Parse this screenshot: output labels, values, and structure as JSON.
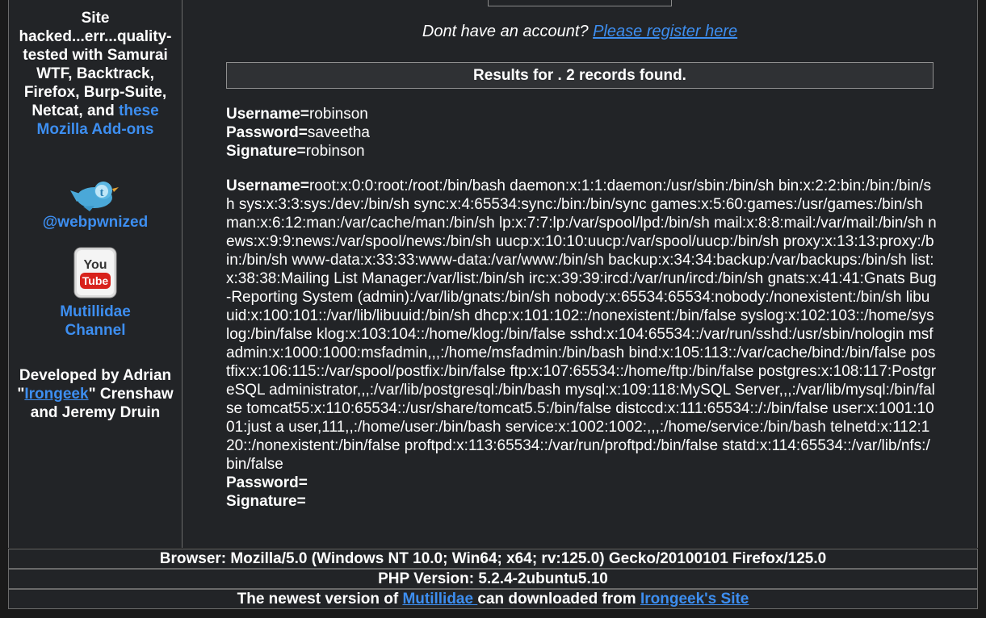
{
  "sidebar": {
    "blurb_prefix": "Site hacked...err...quality-tested with Samurai WTF, Backtrack, Firefox, Burp-Suite, Netcat, and ",
    "blurb_link": "these Mozilla Add-ons",
    "twitter_handle": "@webpwnized",
    "youtube_label": "Mutillidae Channel",
    "dev_prefix": "Developed by Adrian \"",
    "dev_link": "Irongeek",
    "dev_suffix": "\" Crenshaw and Jeremy Druin"
  },
  "main": {
    "register_prompt": "Dont have an account?",
    "register_link": "Please register here",
    "results_header": "Results for . 2 records found.",
    "records": [
      {
        "username_label": "Username=",
        "username": "robinson",
        "password_label": "Password=",
        "password": "saveetha",
        "signature_label": "Signature=",
        "signature": "robinson"
      },
      {
        "username_label": "Username=",
        "username": "root:x:0:0:root:/root:/bin/bash daemon:x:1:1:daemon:/usr/sbin:/bin/sh bin:x:2:2:bin:/bin:/bin/sh sys:x:3:3:sys:/dev:/bin/sh sync:x:4:65534:sync:/bin:/bin/sync games:x:5:60:games:/usr/games:/bin/sh man:x:6:12:man:/var/cache/man:/bin/sh lp:x:7:7:lp:/var/spool/lpd:/bin/sh mail:x:8:8:mail:/var/mail:/bin/sh news:x:9:9:news:/var/spool/news:/bin/sh uucp:x:10:10:uucp:/var/spool/uucp:/bin/sh proxy:x:13:13:proxy:/bin:/bin/sh www-data:x:33:33:www-data:/var/www:/bin/sh backup:x:34:34:backup:/var/backups:/bin/sh list:x:38:38:Mailing List Manager:/var/list:/bin/sh irc:x:39:39:ircd:/var/run/ircd:/bin/sh gnats:x:41:41:Gnats Bug-Reporting System (admin):/var/lib/gnats:/bin/sh nobody:x:65534:65534:nobody:/nonexistent:/bin/sh libuuid:x:100:101::/var/lib/libuuid:/bin/sh dhcp:x:101:102::/nonexistent:/bin/false syslog:x:102:103::/home/syslog:/bin/false klog:x:103:104::/home/klog:/bin/false sshd:x:104:65534::/var/run/sshd:/usr/sbin/nologin msfadmin:x:1000:1000:msfadmin,,,:/home/msfadmin:/bin/bash bind:x:105:113::/var/cache/bind:/bin/false postfix:x:106:115::/var/spool/postfix:/bin/false ftp:x:107:65534::/home/ftp:/bin/false postgres:x:108:117:PostgreSQL administrator,,,:/var/lib/postgresql:/bin/bash mysql:x:109:118:MySQL Server,,,:/var/lib/mysql:/bin/false tomcat55:x:110:65534::/usr/share/tomcat5.5:/bin/false distccd:x:111:65534::/:/bin/false user:x:1001:1001:just a user,111,,:/home/user:/bin/bash service:x:1002:1002:,,,:/home/service:/bin/bash telnetd:x:112:120::/nonexistent:/bin/false proftpd:x:113:65534::/var/run/proftpd:/bin/false statd:x:114:65534::/var/lib/nfs:/bin/false",
        "password_label": "Password=",
        "password": "",
        "signature_label": "Signature=",
        "signature": ""
      }
    ]
  },
  "footer": {
    "browser": "Browser: Mozilla/5.0 (Windows NT 10.0; Win64; x64; rv:125.0) Gecko/20100101 Firefox/125.0",
    "php_version": "PHP Version: 5.2.4-2ubuntu5.10",
    "newest_prefix": "The newest version of ",
    "mutillidae_link": "Mutillidae ",
    "newest_middle": "can downloaded from ",
    "irongeek_site_link": "Irongeek's Site"
  },
  "colors": {
    "background": "#1a1a1a",
    "panel": "#222427",
    "link": "#3d8ef0",
    "header_bar": "#2f3134"
  },
  "icons": [
    "twitter-bird-icon",
    "youtube-icon"
  ]
}
